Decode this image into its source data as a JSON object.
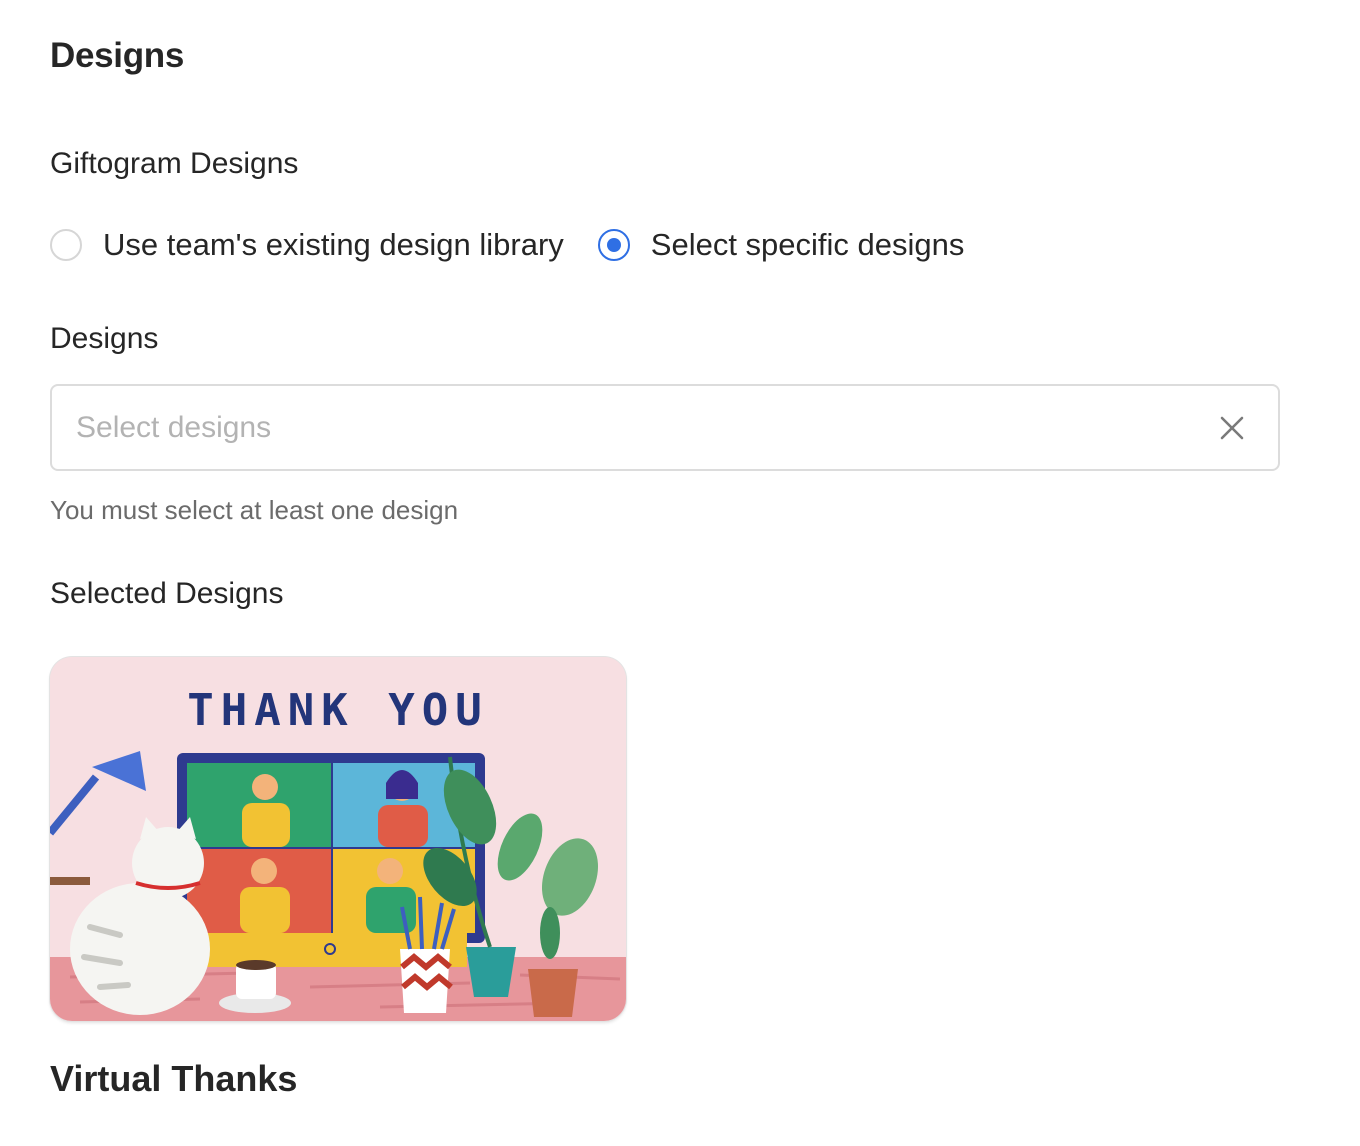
{
  "page": {
    "title": "Designs"
  },
  "giftogram_designs": {
    "label": "Giftogram Designs",
    "options": [
      {
        "label": "Use team's existing design library",
        "checked": false
      },
      {
        "label": "Select specific designs",
        "checked": true
      }
    ]
  },
  "designs_field": {
    "label": "Designs",
    "placeholder": "Select designs",
    "value": "",
    "helper_text": "You must select at least one design",
    "clear_icon": "close-icon"
  },
  "selected_designs": {
    "label": "Selected Designs",
    "items": [
      {
        "headline": "THANK YOU",
        "name": "Virtual Thanks"
      }
    ]
  },
  "colors": {
    "accent": "#2f6fe4",
    "text": "#262626",
    "muted_text": "#6b6b6b",
    "border": "#dcdcdc",
    "card_background": "#f7dfe2",
    "card_headline": "#23357a"
  }
}
